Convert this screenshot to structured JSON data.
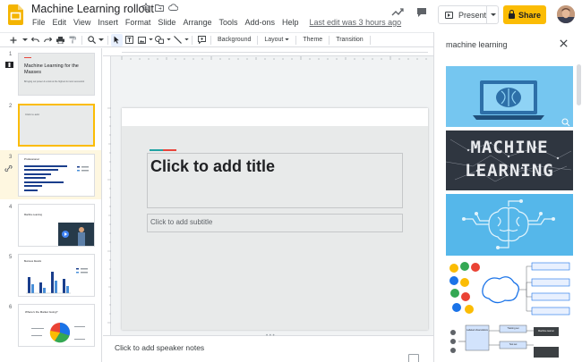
{
  "document": {
    "title": "Machine Learning rollout",
    "menu": [
      "File",
      "Edit",
      "View",
      "Insert",
      "Format",
      "Slide",
      "Arrange",
      "Tools",
      "Add-ons",
      "Help"
    ],
    "last_edit": "Last edit was 3 hours ago"
  },
  "header_actions": {
    "present_label": "Present",
    "share_label": "Share"
  },
  "toolbar": {
    "background_label": "Background",
    "layout_label": "Layout",
    "theme_label": "Theme",
    "transition_label": "Transition"
  },
  "slides": [
    {
      "number": "1",
      "title": "Machine Learning for the Masses",
      "subtitle": "Bringing out power & a look at the highest & most successful"
    },
    {
      "number": "2",
      "label": "Click to add"
    },
    {
      "number": "3",
      "title": "Professional"
    },
    {
      "number": "4",
      "title": "Machine Learning"
    },
    {
      "number": "5",
      "title": "Business Results"
    },
    {
      "number": "6",
      "title": "Where's the Market Going?"
    }
  ],
  "current_slide": {
    "title_placeholder": "Click to add title",
    "subtitle_placeholder": "Click to add subtitle"
  },
  "speaker_notes": {
    "placeholder": "Click to add speaker notes"
  },
  "explore": {
    "query": "machine learning",
    "results": [
      {
        "icon": "laptop-brain-illustration"
      },
      {
        "word1": "MACHINE",
        "word2": "LEARNING"
      },
      {
        "icon": "circuit-brain-illustration"
      },
      {
        "icon": "brain-flowchart-diagram"
      },
      {
        "icon": "ml-process-diagram",
        "labels": [
          "Labeled observations",
          "Training set",
          "Machine learner",
          "Test set"
        ]
      }
    ]
  },
  "colors": {
    "accent_yellow": "#fbbc04",
    "slides_logo": "#f4b400",
    "accent_red": "#e8453c",
    "accent_teal": "#21a3a3",
    "result_sky": "#75c6f0",
    "result_dark": "#2f3640"
  }
}
